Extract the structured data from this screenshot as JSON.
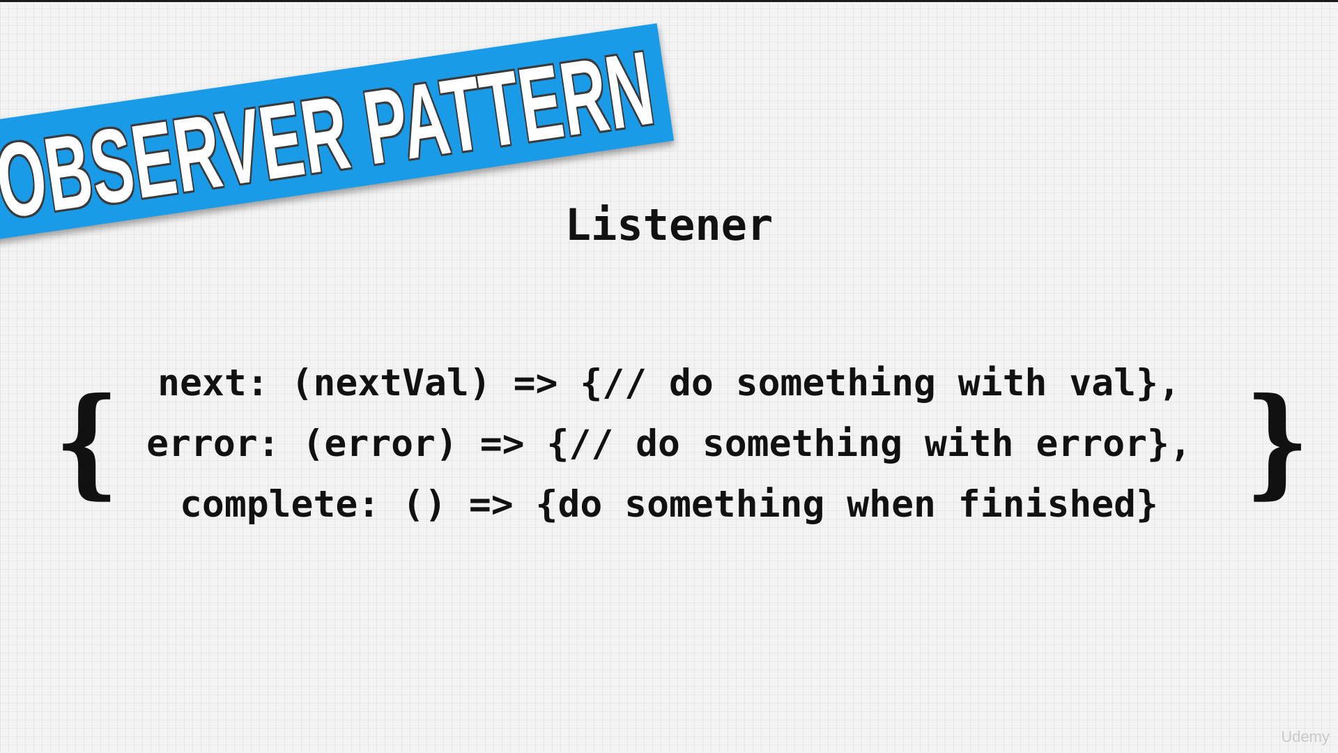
{
  "banner": {
    "title": "OBSERVER PATTERN",
    "color": "#1a9be8"
  },
  "subtitle": "Listener",
  "braces": {
    "open": "{",
    "close": "}"
  },
  "code": {
    "lines": [
      "next: (nextVal) => {// do something with val},",
      "error: (error) => {// do something with error},",
      "complete: () => {do something when finished}"
    ]
  },
  "watermark": "Udemy"
}
